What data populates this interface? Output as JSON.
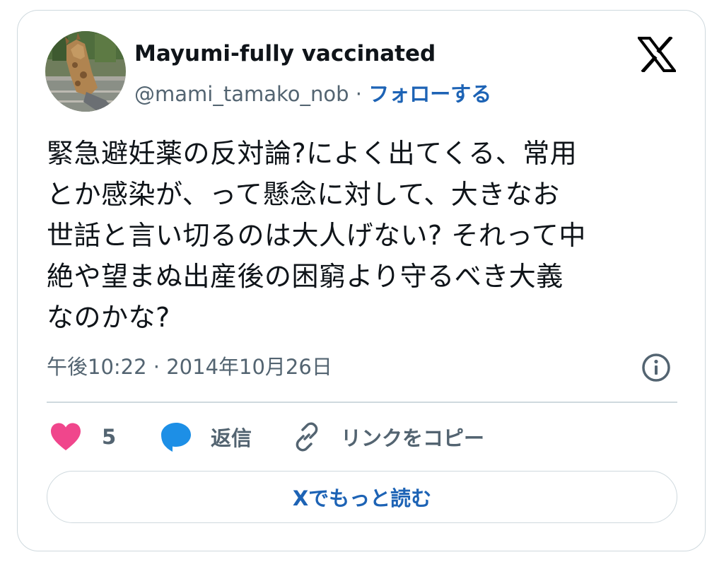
{
  "author": {
    "display_name": "Mayumi-fully vaccinated",
    "handle": "@mami_tamako_nob",
    "separator": "·",
    "follow_label": "フォローする"
  },
  "tweet": {
    "lines": [
      "緊急避妊薬の反対論?によく出てくる、常用",
      "とか感染が、って懸念に対して、大きなお",
      "世話と言い切るのは大人げない? それって中",
      "絶や望まぬ出産後の困窮より守るべき大義",
      "なのかな?"
    ],
    "timestamp": "午後10:22 · 2014年10月26日"
  },
  "actions": {
    "like_count": "5",
    "reply_label": "返信",
    "copy_link_label": "リンクをコピー",
    "read_more_label": "Xでもっと読む"
  },
  "colors": {
    "link_blue": "#1d63b5",
    "like_pink": "#f0468c",
    "reply_blue": "#1d8fe6",
    "muted_text": "#536471",
    "border": "#cfd9de"
  },
  "icons": {
    "logo": "x-logo-icon",
    "info": "info-icon",
    "like": "heart-icon",
    "reply": "speech-bubble-icon",
    "copy_link": "link-icon"
  }
}
